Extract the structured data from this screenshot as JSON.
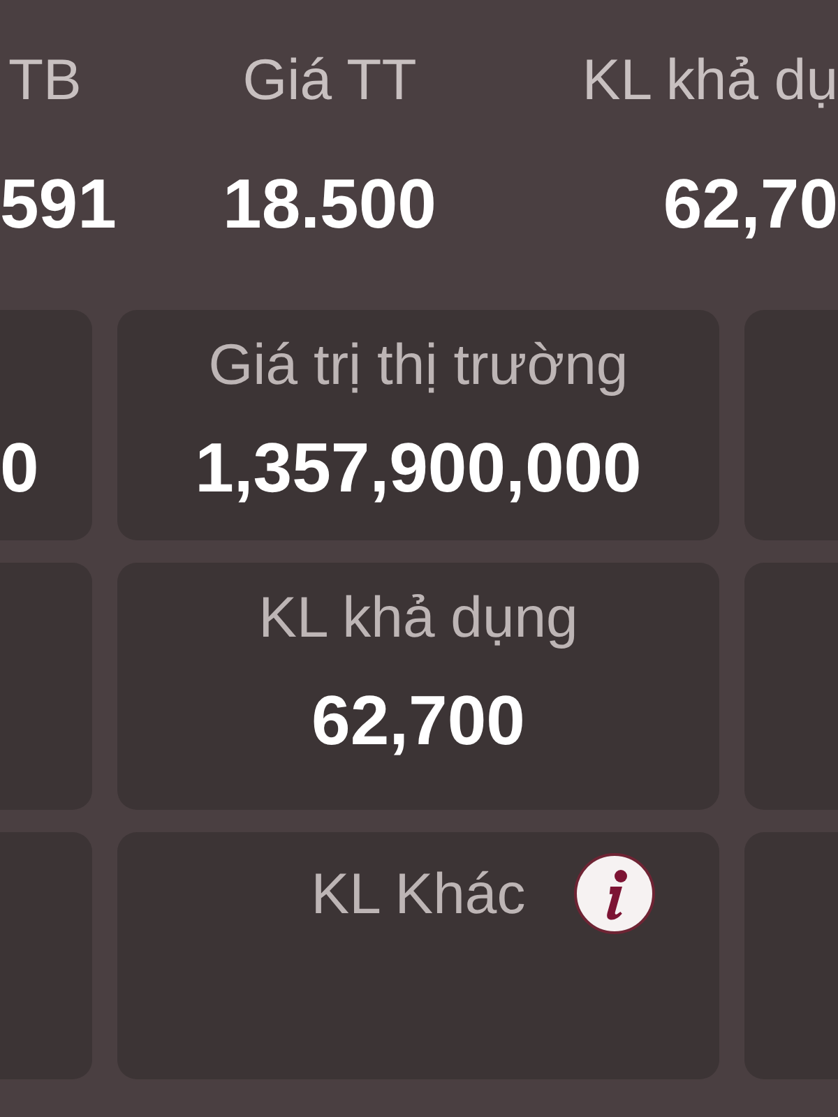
{
  "summary_columns": [
    {
      "label": "TB",
      "value": "591"
    },
    {
      "label": "Giá TT",
      "value": "18.500"
    },
    {
      "label": "KL khả dụ",
      "value": "62,70"
    }
  ],
  "card_rows": [
    {
      "cards": [
        {
          "kind": "left_edge",
          "value": "0"
        },
        {
          "kind": "full",
          "label": "Giá trị thị trường",
          "value": "1,357,900,000",
          "info_button": false
        },
        {
          "kind": "right_edge"
        }
      ]
    },
    {
      "cards": [
        {
          "kind": "left_edge"
        },
        {
          "kind": "full",
          "label": "KL khả dụng",
          "value": "62,700",
          "info_button": false
        },
        {
          "kind": "right_edge"
        }
      ]
    },
    {
      "cards": [
        {
          "kind": "left_edge"
        },
        {
          "kind": "full",
          "label": "KL Khác",
          "info_button": true
        },
        {
          "kind": "right_edge"
        }
      ]
    }
  ]
}
